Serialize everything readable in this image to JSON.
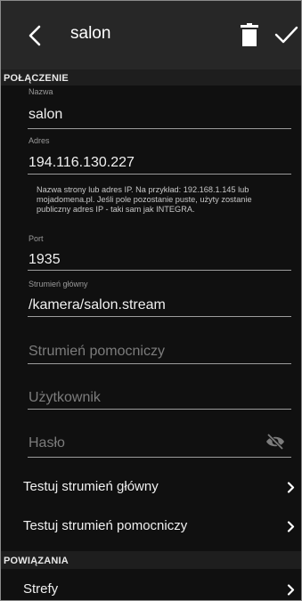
{
  "header": {
    "title": "salon"
  },
  "sections": {
    "connection": "POŁĄCZENIE",
    "associations": "POWIĄZANIA"
  },
  "fields": {
    "name": {
      "label": "Nazwa",
      "value": "salon"
    },
    "address": {
      "label": "Adres",
      "value": "194.116.130.227",
      "help": "Nazwa strony lub adres IP. Na przykład: 192.168.1.145 lub mojadomena.pl. Jeśli pole pozostanie puste, użyty zostanie publiczny adres IP - taki sam jak INTEGRA."
    },
    "port": {
      "label": "Port",
      "value": "1935"
    },
    "main_stream": {
      "label": "Strumień główny",
      "value": "/kamera/salon.stream"
    },
    "aux_stream": {
      "placeholder": "Strumień pomocniczy"
    },
    "user": {
      "placeholder": "Użytkownik"
    },
    "password": {
      "placeholder": "Hasło"
    }
  },
  "rows": {
    "test_main": "Testuj strumień główny",
    "test_aux": "Testuj strumień pomocniczy",
    "zones": "Strefy"
  },
  "icons": {
    "back": "back-arrow-icon",
    "delete": "trash-icon",
    "confirm": "check-icon",
    "visibility": "visibility-off-icon",
    "chevron": "chevron-right-icon"
  },
  "colors": {
    "header_bg": "#272727",
    "body_bg": "#101010",
    "text": "#f0f0f0",
    "hint": "#7c7c7c"
  }
}
